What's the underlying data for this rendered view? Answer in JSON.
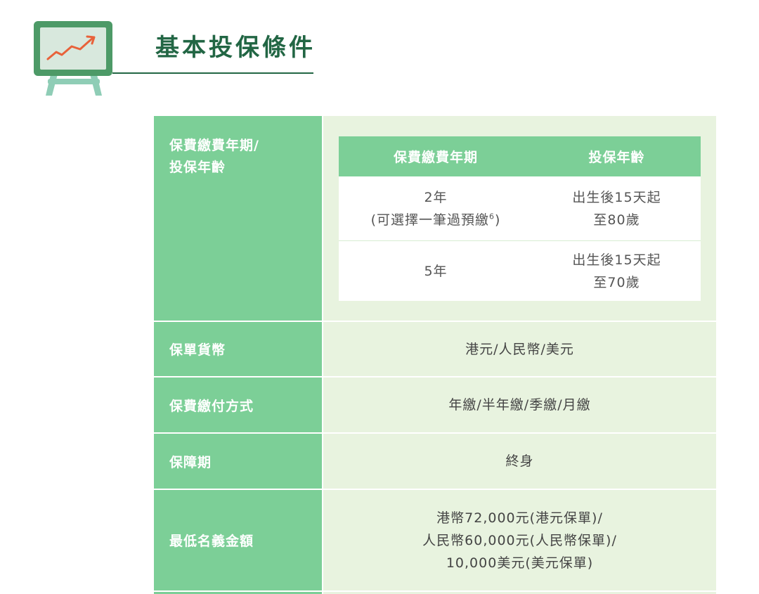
{
  "header": {
    "title": "基本投保條件",
    "icon": "chart-easel-icon"
  },
  "colors": {
    "primary_green": "#7ccf97",
    "light_green": "#e8f3df",
    "dark_green": "#226644",
    "trend_arrow": "#e8623a"
  },
  "terms": {
    "premium_term_age": {
      "label_line1": "保費繳費年期/",
      "label_line2": "投保年齡",
      "sub_table": {
        "col_term": "保費繳費年期",
        "col_age": "投保年齡",
        "rows": [
          {
            "term_line1": "2年",
            "term_line2": "(可選擇一筆過預繳",
            "term_sup": "6",
            "term_close": ")",
            "age_line1": "出生後15天起",
            "age_line2": "至80歲"
          },
          {
            "term_line1": "5年",
            "age_line1": "出生後15天起",
            "age_line2": "至70歲"
          }
        ]
      }
    },
    "policy_currency": {
      "label": "保單貨幣",
      "value": "港元/人民幣/美元"
    },
    "payment_mode": {
      "label": "保費繳付方式",
      "value": "年繳/半年繳/季繳/月繳"
    },
    "benefit_term": {
      "label": "保障期",
      "value": "終身"
    },
    "min_notional": {
      "label": "最低名義金額",
      "value_line1": "港幣72,000元(港元保單)/",
      "value_line2": "人民幣60,000元(人民幣保單)/",
      "value_line3": "10,000美元(美元保單)"
    }
  }
}
